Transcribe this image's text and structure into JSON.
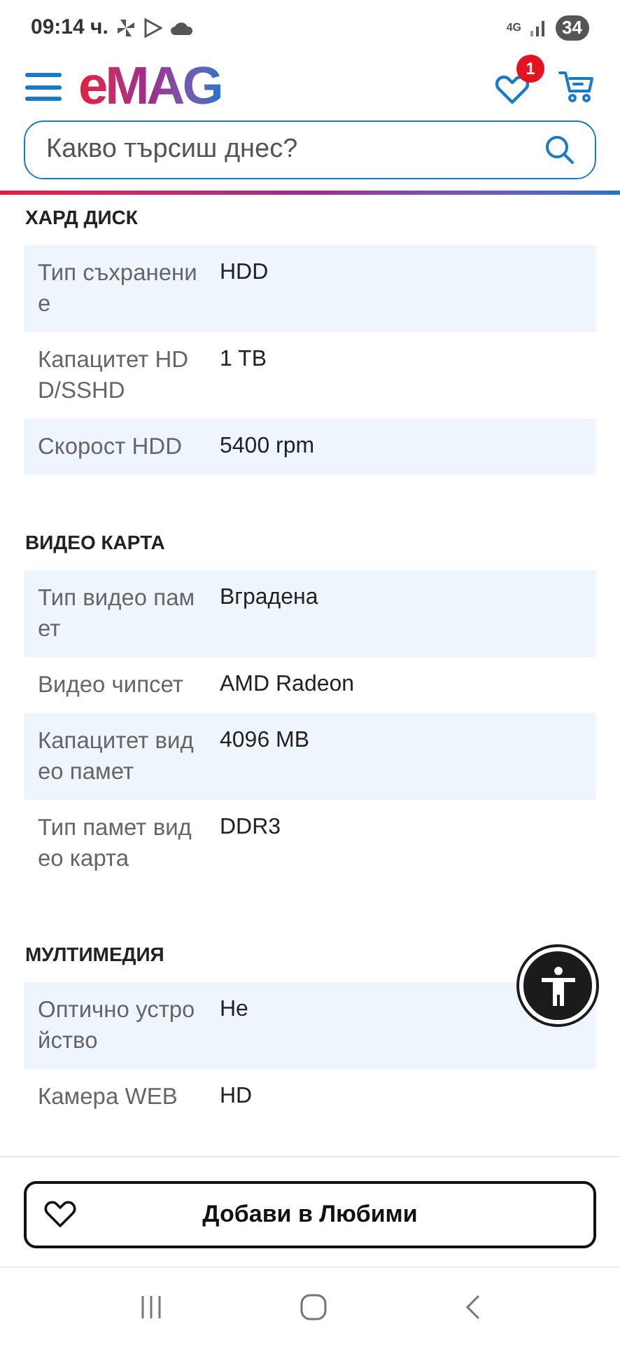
{
  "status_bar": {
    "time": "09:14 ч.",
    "network": "4G",
    "battery": "34"
  },
  "header": {
    "logo": "eMAG",
    "favorites_badge": "1"
  },
  "search": {
    "placeholder": "Какво търсиш днес?"
  },
  "sections": [
    {
      "title": "ХАРД ДИСК",
      "rows": [
        {
          "label": "Тип съхранение",
          "value": "HDD"
        },
        {
          "label": "Капацитет HDD/SSHD",
          "value": "1 TB"
        },
        {
          "label": "Скорост HDD",
          "value": "5400 rpm"
        }
      ]
    },
    {
      "title": "ВИДЕО КАРТА",
      "rows": [
        {
          "label": "Тип видео памет",
          "value": "Вградена"
        },
        {
          "label": "Видео чипсет",
          "value": "AMD Radeon"
        },
        {
          "label": "Капацитет видео памет",
          "value": "4096 MB"
        },
        {
          "label": "Тип памет видео карта",
          "value": "DDR3"
        }
      ]
    },
    {
      "title": "МУЛТИМЕДИЯ",
      "rows": [
        {
          "label": "Оптично устройство",
          "value": "Не"
        },
        {
          "label": "Камера WEB",
          "value": "HD"
        }
      ]
    }
  ],
  "bottom_button": {
    "label": "Добави в Любими"
  }
}
